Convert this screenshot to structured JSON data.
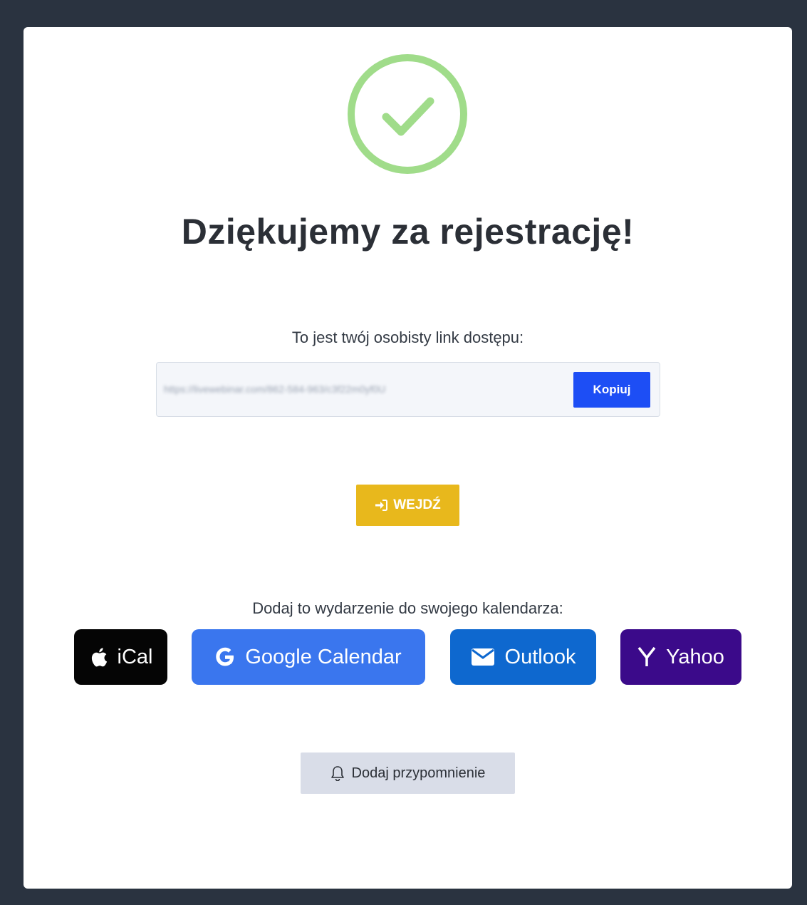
{
  "page": {
    "title": "Dziękujemy za rejestrację!",
    "link_label": "To jest twój osobisty link dostępu:",
    "access_link": "https://livewebinar.com/862-584-963/c3f22m0yf0U",
    "copy_label": "Kopiuj",
    "enter_label": "WEJDŹ",
    "calendar_label": "Dodaj to wydarzenie do swojego kalendarza:",
    "reminder_label": "Dodaj przypomnienie"
  },
  "calendars": [
    {
      "label": "iCal",
      "icon": "apple-icon",
      "color": "#050505"
    },
    {
      "label": "Google Calendar",
      "icon": "google-icon",
      "color": "#3a76ee"
    },
    {
      "label": "Outlook",
      "icon": "envelope-icon",
      "color": "#0e68cf"
    },
    {
      "label": "Yahoo",
      "icon": "yahoo-icon",
      "color": "#3b0a8a"
    }
  ],
  "colors": {
    "success": "#a0dc8a",
    "primary": "#1d4ef5",
    "warning": "#e8b81c",
    "background": "#2a3340"
  }
}
